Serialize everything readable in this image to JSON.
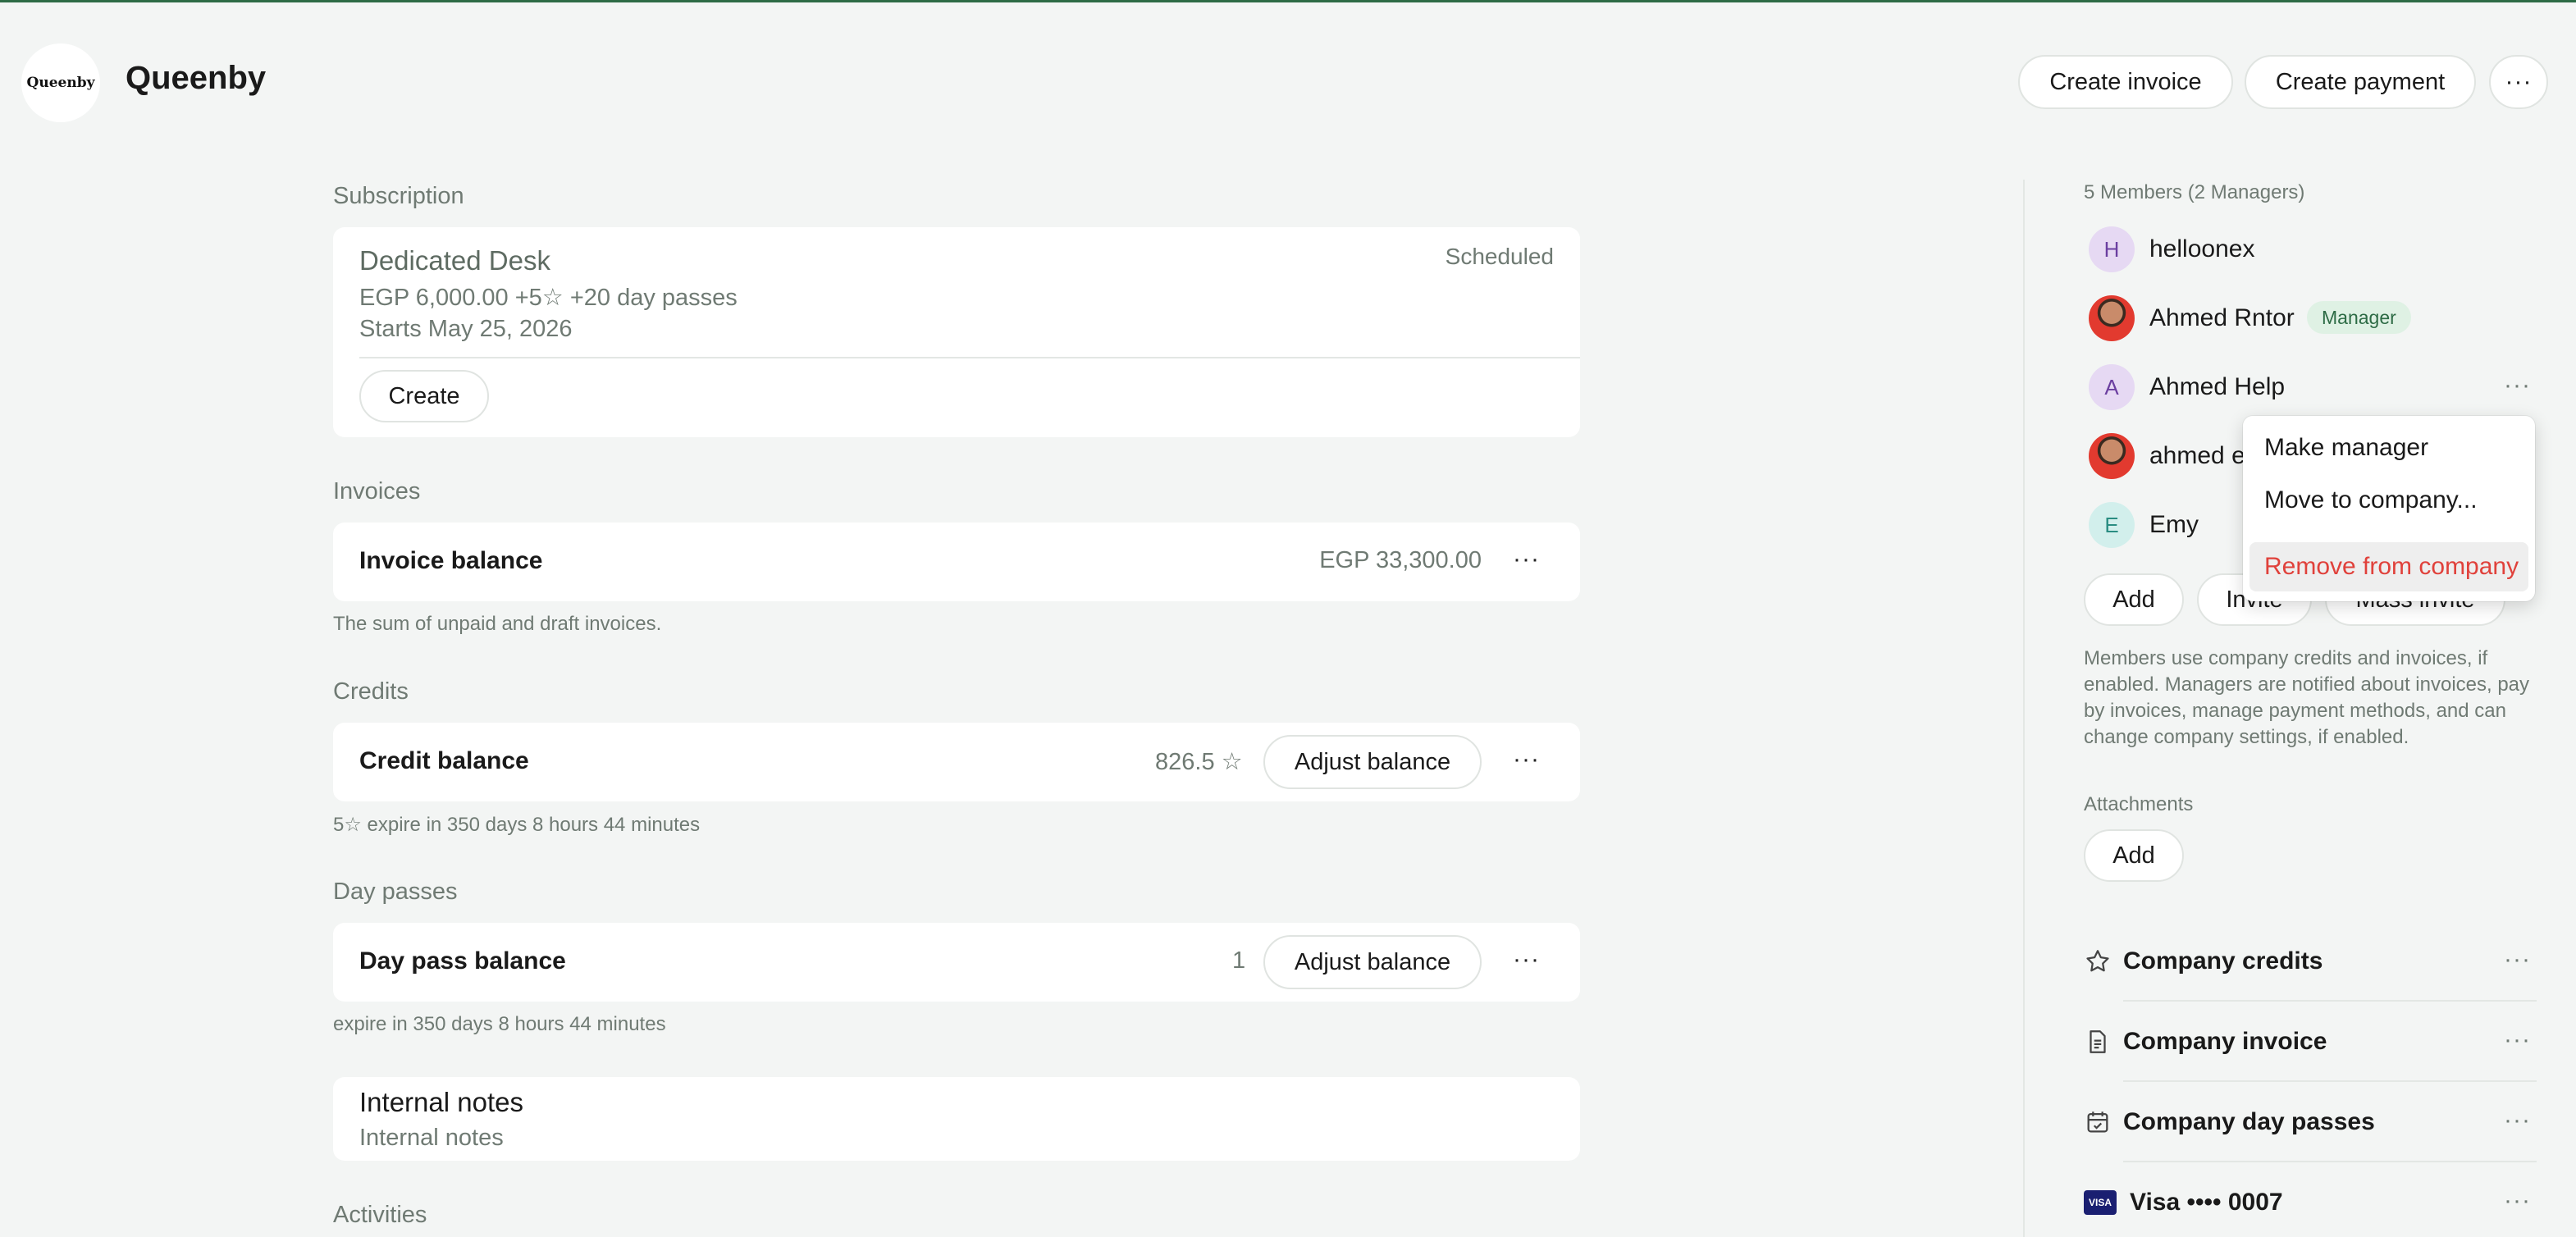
{
  "header": {
    "logo_text": "Queenby",
    "company_name": "Queenby",
    "create_invoice_label": "Create invoice",
    "create_payment_label": "Create payment",
    "more_label": "···"
  },
  "subscription": {
    "section_title": "Subscription",
    "plan_name": "Dedicated Desk",
    "price_line": "EGP 6,000.00 +5☆ +20 day passes",
    "start_line": "Starts May 25, 2026",
    "status": "Scheduled",
    "create_label": "Create"
  },
  "invoices": {
    "section_title": "Invoices",
    "row_title": "Invoice balance",
    "amount": "EGP 33,300.00",
    "hint": "The sum of unpaid and draft invoices."
  },
  "credits": {
    "section_title": "Credits",
    "row_title": "Credit balance",
    "amount": "826.5 ☆",
    "adjust_label": "Adjust balance",
    "hint": "5☆ expire in 350 days 8 hours 44 minutes"
  },
  "day_passes": {
    "section_title": "Day passes",
    "row_title": "Day pass balance",
    "amount": "1",
    "adjust_label": "Adjust balance",
    "hint": "expire in 350 days 8 hours 44 minutes"
  },
  "internal_notes": {
    "title": "Internal notes",
    "placeholder": "Internal notes"
  },
  "activities": {
    "section_title": "Activities"
  },
  "members": {
    "summary": "5 Members (2 Managers)",
    "items": [
      {
        "name": "helloonex",
        "initial": "H"
      },
      {
        "name": "Ahmed Rntor",
        "badge": "Manager"
      },
      {
        "name": "Ahmed Help",
        "initial": "A"
      },
      {
        "name": "ahmed e"
      },
      {
        "name": "Emy",
        "initial": "E"
      }
    ],
    "add_label": "Add",
    "invite_label": "Invite",
    "mass_invite_label": "Mass invite",
    "description": "Members use company credits and invoices, if enabled. Managers are notified about invoices, pay by invoices, manage payment methods, and can change company settings, if enabled."
  },
  "menu": {
    "make_manager": "Make manager",
    "move_to_company": "Move to company...",
    "remove_from_company": "Remove from company"
  },
  "attachments": {
    "section_title": "Attachments",
    "add_label": "Add"
  },
  "settings_list": {
    "company_credits": "Company credits",
    "company_invoice": "Company invoice",
    "company_day_passes": "Company day passes",
    "visa_label": "Visa •••• 0007",
    "visa_brand": "VISA"
  },
  "colors": {
    "accent_green": "#2d6b45",
    "danger_red": "#e0413b",
    "badge_bg": "#dff1e4",
    "page_bg": "#f3f5f4"
  }
}
